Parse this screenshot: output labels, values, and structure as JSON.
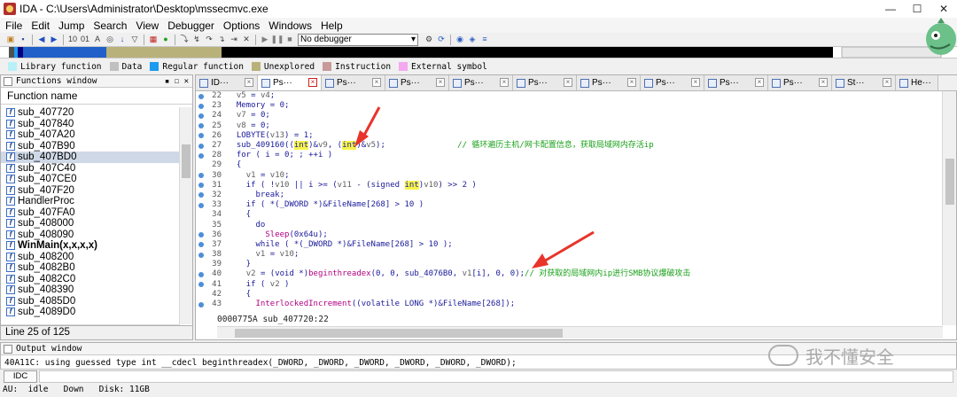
{
  "window": {
    "title": "IDA - C:\\Users\\Administrator\\Desktop\\mssecmvc.exe",
    "minimize": "—",
    "maximize": "☐",
    "close": "✕"
  },
  "menu": [
    "File",
    "Edit",
    "Jump",
    "Search",
    "View",
    "Debugger",
    "Options",
    "Windows",
    "Help"
  ],
  "toolbar": {
    "debugger_select": "No debugger"
  },
  "legend": [
    {
      "label": "Library function",
      "color": "#b8f0f8"
    },
    {
      "label": "Data",
      "color": "#c0c0c0"
    },
    {
      "label": "Regular function",
      "color": "#1e9aee"
    },
    {
      "label": "Unexplored",
      "color": "#b8b27a"
    },
    {
      "label": "Instruction",
      "color": "#c89a9a"
    },
    {
      "label": "External symbol",
      "color": "#f4a8f0"
    }
  ],
  "functions_window": {
    "title": "Functions window",
    "column": "Function name",
    "items": [
      "sub_407720",
      "sub_407840",
      "sub_407A20",
      "sub_407B90",
      "sub_407BD0",
      "sub_407C40",
      "sub_407CE0",
      "sub_407F20",
      "HandlerProc",
      "sub_407FA0",
      "sub_408000",
      "sub_408090",
      "WinMain(x,x,x,x)",
      "sub_408200",
      "sub_4082B0",
      "sub_4082C0",
      "sub_408390",
      "sub_4085D0",
      "sub_4089D0"
    ],
    "selected_index": 4,
    "bold_index": 12,
    "line_info": "Line 25 of 125"
  },
  "tabs": [
    {
      "label": "ID···",
      "active": false
    },
    {
      "label": "Ps···",
      "active": true
    },
    {
      "label": "Ps···",
      "active": false
    },
    {
      "label": "Ps···",
      "active": false
    },
    {
      "label": "Ps···",
      "active": false
    },
    {
      "label": "Ps···",
      "active": false
    },
    {
      "label": "Ps···",
      "active": false
    },
    {
      "label": "Ps···",
      "active": false
    },
    {
      "label": "Ps···",
      "active": false
    },
    {
      "label": "Ps···",
      "active": false
    },
    {
      "label": "St···",
      "active": false
    },
    {
      "label": "He···",
      "active": false
    }
  ],
  "code_lines": [
    {
      "n": "22",
      "dot": true,
      "html": "  <span class='var'>v5</span> = <span class='var'>v4</span>;"
    },
    {
      "n": "23",
      "dot": true,
      "html": "  Memory = <span class='num'>0</span>;"
    },
    {
      "n": "24",
      "dot": true,
      "html": "  <span class='var'>v7</span> = <span class='num'>0</span>;"
    },
    {
      "n": "25",
      "dot": true,
      "html": "  <span class='var'>v8</span> = <span class='num'>0</span>;"
    },
    {
      "n": "26",
      "dot": true,
      "html": "  LOBYTE(<span class='var'>v13</span>) = <span class='num'>1</span>;"
    },
    {
      "n": "27",
      "dot": true,
      "html": "  sub_409160((<span class='hl'>int</span>)&amp;<span class='var'>v9</span>, (<span class='hl'>int</span>)&amp;<span class='var'>v5</span>);               <span class='cm'>// 循环遍历主机/网卡配置信息，获取局域网内存活ip</span>"
    },
    {
      "n": "28",
      "dot": true,
      "html": "  for ( i = <span class='num'>0</span>; ; ++i )"
    },
    {
      "n": "29",
      "dot": false,
      "html": "  {"
    },
    {
      "n": "30",
      "dot": true,
      "html": "    <span class='var'>v1</span> = <span class='var'>v10</span>;"
    },
    {
      "n": "31",
      "dot": true,
      "html": "    if ( !<span class='var'>v10</span> || i &gt;= (<span class='var'>v11</span> - (signed <span class='hl'>int</span>)<span class='var'>v10</span>) &gt;&gt; <span class='num'>2</span> )"
    },
    {
      "n": "32",
      "dot": true,
      "html": "      break;"
    },
    {
      "n": "33",
      "dot": true,
      "html": "    if ( *(_DWORD *)&amp;FileName[<span class='num'>268</span>] &gt; <span class='num'>10</span> )"
    },
    {
      "n": "34",
      "dot": false,
      "html": "    {"
    },
    {
      "n": "35",
      "dot": false,
      "html": "      do"
    },
    {
      "n": "36",
      "dot": true,
      "html": "        <span class='fn'>Sleep</span>(<span class='num'>0x64u</span>);"
    },
    {
      "n": "37",
      "dot": true,
      "html": "      while ( *(_DWORD *)&amp;FileName[<span class='num'>268</span>] &gt; <span class='num'>10</span> );"
    },
    {
      "n": "38",
      "dot": true,
      "html": "      <span class='var'>v1</span> = <span class='var'>v10</span>;"
    },
    {
      "n": "39",
      "dot": false,
      "html": "    }"
    },
    {
      "n": "40",
      "dot": true,
      "html": "    <span class='var'>v2</span> = (void *)<span class='fn'>beginthreadex</span>(<span class='num'>0</span>, <span class='num'>0</span>, sub_4076B0, <span class='var'>v1</span>[i], <span class='num'>0</span>, <span class='num'>0</span>);<span class='cm'>// 对获取的局域网内ip进行SMB协议爆破攻击</span>"
    },
    {
      "n": "41",
      "dot": true,
      "html": "    if ( <span class='var'>v2</span> )"
    },
    {
      "n": "42",
      "dot": false,
      "html": "    {"
    },
    {
      "n": "43",
      "dot": true,
      "html": "      <span class='fn'>InterlockedIncrement</span>((volatile LONG *)&amp;FileName[<span class='num'>268</span>]);"
    }
  ],
  "code_status": "0000775A sub_407720:22",
  "output_window": {
    "title": "Output window",
    "text": "40A11C: using guessed type int __cdecl beginthreadex(_DWORD, _DWORD, _DWORD, _DWORD, _DWORD, _DWORD);"
  },
  "idc_button": "IDC",
  "status_bar": "AU:  idle   Down   Disk: 11GB",
  "watermark": "我不懂安全",
  "arrow_color": "#e8342a"
}
